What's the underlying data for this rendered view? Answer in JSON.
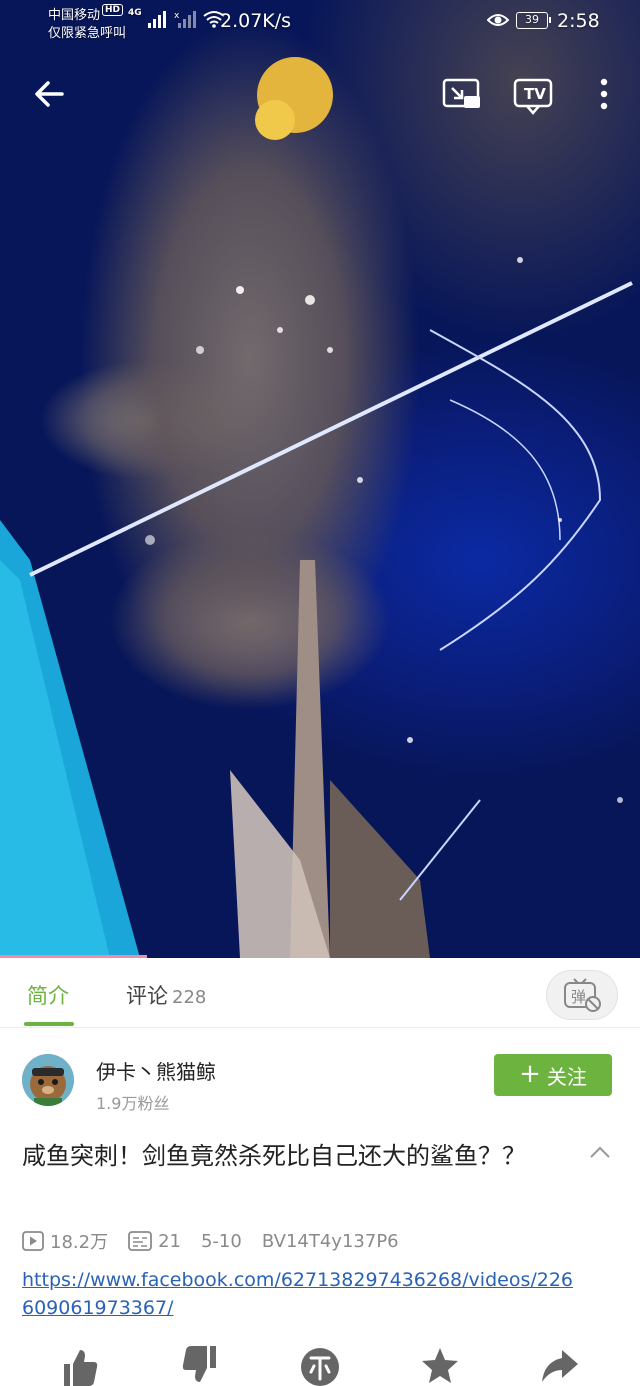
{
  "status_bar": {
    "carrier": "中国移动",
    "hd": "HD",
    "emergency": "仅限紧急呼叫",
    "network": "4G",
    "speed": "2.07K/s",
    "battery": "39",
    "time": "2:58"
  },
  "player": {
    "progress": 0.23
  },
  "tabs": {
    "intro_label": "简介",
    "comments_label": "评论",
    "comments_count": "228",
    "danmaku_label": "弹"
  },
  "uploader": {
    "name": "伊卡丶熊猫鲸",
    "fans": "1.9万粉丝",
    "follow_label": "关注"
  },
  "video": {
    "title": "咸鱼突刺！剑鱼竟然杀死比自己还大的鲨鱼？？",
    "views": "18.2万",
    "danmaku_count": "21",
    "date": "5-10",
    "bvid": "BV14T4y137P6",
    "link": "https://www.facebook.com/627138297436268/videos/226609061973367/"
  },
  "colors": {
    "accent": "#6cb33f",
    "link": "#2a62b5",
    "progress": "#f08bb0"
  },
  "icons": [
    "back-arrow-icon",
    "cast-icon",
    "tv-icon",
    "more-icon",
    "eye-icon",
    "danmaku-icon",
    "play-count-icon",
    "danmaku-count-icon",
    "like-icon",
    "dislike-icon",
    "coin-icon",
    "favorite-icon",
    "share-icon",
    "chevron-up-icon"
  ]
}
